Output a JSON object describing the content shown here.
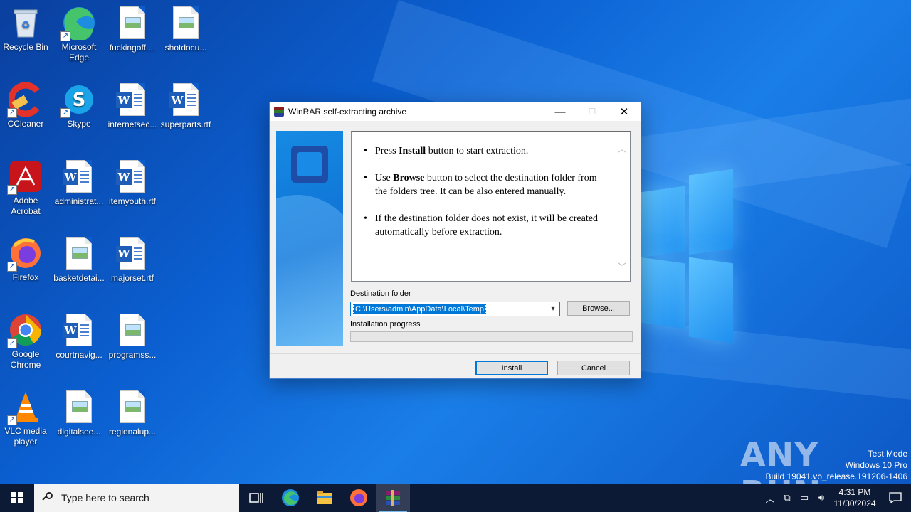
{
  "desktop": {
    "icons": [
      {
        "label": "Recycle Bin",
        "icon": "recycle-bin-icon"
      },
      {
        "label": "Microsoft Edge",
        "icon": "edge-icon"
      },
      {
        "label": "fuckingoff....",
        "icon": "image-file-icon"
      },
      {
        "label": "shotdocu...",
        "icon": "image-file-icon"
      },
      {
        "label": "CCleaner",
        "icon": "ccleaner-icon"
      },
      {
        "label": "Skype",
        "icon": "skype-icon"
      },
      {
        "label": "internetsec...",
        "icon": "word-doc-icon"
      },
      {
        "label": "superparts.rtf",
        "icon": "word-doc-icon"
      },
      {
        "label": "Adobe Acrobat",
        "icon": "acrobat-icon"
      },
      {
        "label": "administrat...",
        "icon": "word-doc-icon"
      },
      {
        "label": "itemyouth.rtf",
        "icon": "word-doc-icon"
      },
      {
        "label": "Firefox",
        "icon": "firefox-icon"
      },
      {
        "label": "basketdetai...",
        "icon": "image-file-icon"
      },
      {
        "label": "majorset.rtf",
        "icon": "word-doc-icon"
      },
      {
        "label": "Google Chrome",
        "icon": "chrome-icon"
      },
      {
        "label": "courtnavig...",
        "icon": "word-doc-icon"
      },
      {
        "label": "programss...",
        "icon": "image-file-icon"
      },
      {
        "label": "VLC media player",
        "icon": "vlc-icon"
      },
      {
        "label": "digitalsee...",
        "icon": "image-file-icon"
      },
      {
        "label": "regionalup...",
        "icon": "image-file-icon"
      }
    ]
  },
  "dialog": {
    "title": "WinRAR self-extracting archive",
    "minimize": "—",
    "maximize": "☐",
    "close": "✕",
    "instructions": [
      {
        "pre": "Press ",
        "bold": "Install",
        "post": " button to start extraction."
      },
      {
        "pre": "Use ",
        "bold": "Browse",
        "post": " button to select the destination folder from the folders tree. It can be also entered manually."
      },
      {
        "pre": "",
        "bold": "",
        "post": "If the destination folder does not exist, it will be created automatically before extraction."
      }
    ],
    "destination_label": "Destination folder",
    "destination_value": "C:\\Users\\admin\\AppData\\Local\\Temp",
    "browse_label": "Browse...",
    "progress_label": "Installation progress",
    "progress_value": 0,
    "install_label": "Install",
    "cancel_label": "Cancel"
  },
  "watermark": {
    "brand": "ANY RUN",
    "line1": "Test Mode",
    "line2": "Windows 10 Pro",
    "line3": "Build 19041.vb_release.191206-1406"
  },
  "taskbar": {
    "search_placeholder": "Type here to search",
    "apps": [
      "task-view-icon",
      "edge-icon",
      "file-explorer-icon",
      "firefox-icon",
      "winrar-icon"
    ],
    "time": "4:31 PM",
    "date": "11/30/2024"
  }
}
